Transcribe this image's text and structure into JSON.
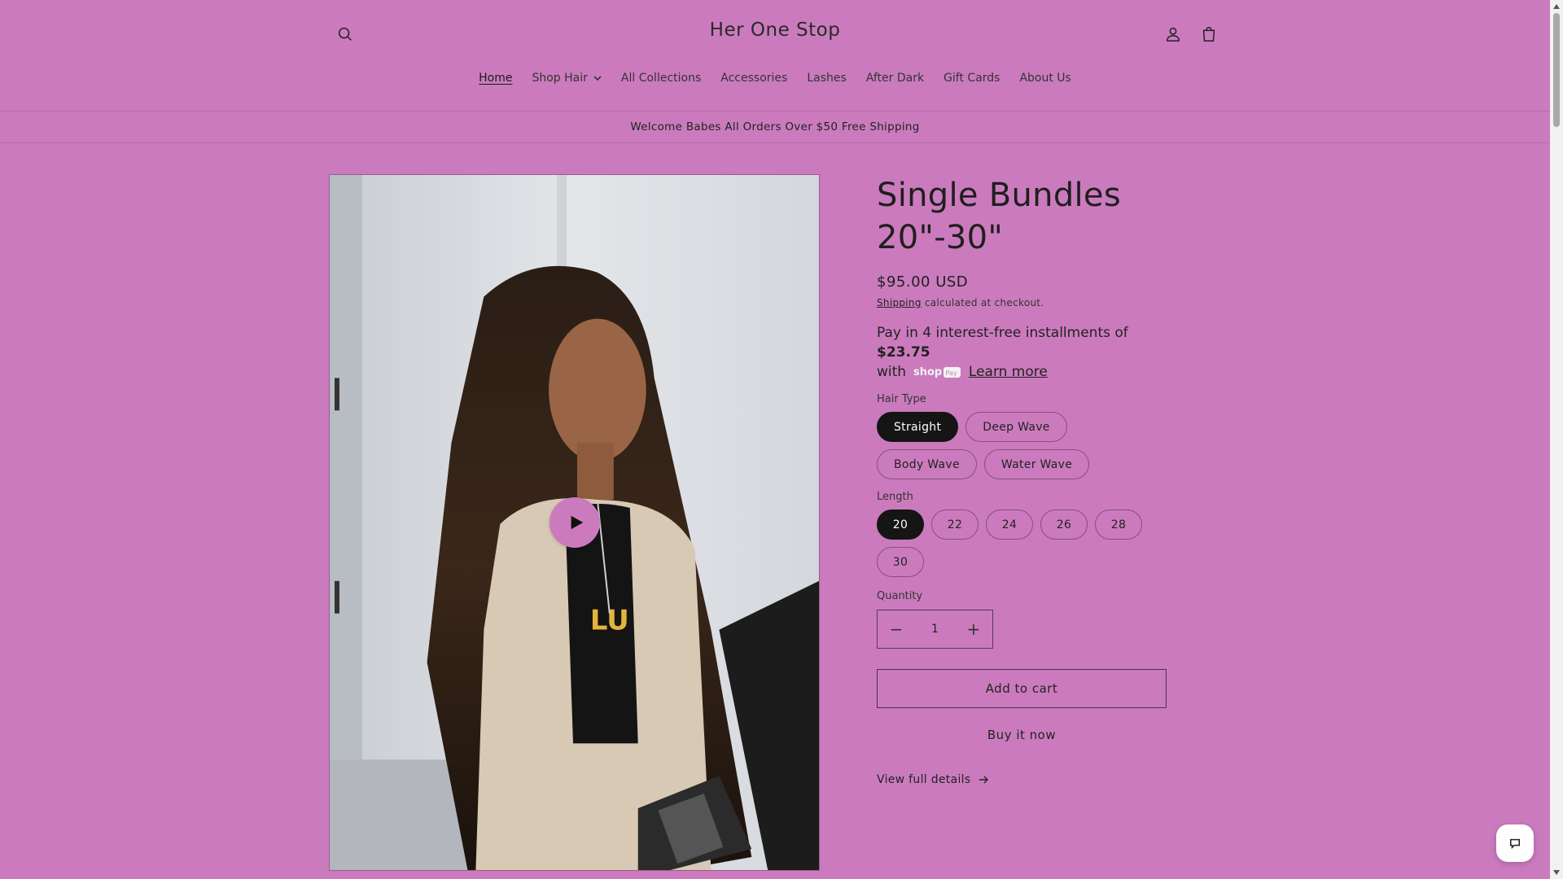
{
  "store": {
    "name": "Her One Stop"
  },
  "nav": [
    {
      "label": "Home",
      "active": true
    },
    {
      "label": "Shop Hair",
      "dropdown": true
    },
    {
      "label": "All Collections"
    },
    {
      "label": "Accessories"
    },
    {
      "label": "Lashes"
    },
    {
      "label": "After Dark"
    },
    {
      "label": "Gift Cards"
    },
    {
      "label": "About Us"
    }
  ],
  "announcement": "Welcome Babes All Orders Over $50 Free Shipping",
  "product": {
    "title": "Single Bundles 20\"-30\"",
    "price": "$95.00 USD",
    "shipping_link": "Shipping",
    "shipping_text": " calculated at checkout.",
    "installments_prefix": "Pay in 4 interest-free installments of ",
    "installments_amount": "$23.75",
    "installments_with": "with",
    "learn_more": "Learn more",
    "hair_type_label": "Hair Type",
    "hair_types": [
      "Straight",
      "Deep Wave",
      "Body Wave",
      "Water Wave"
    ],
    "hair_type_selected": "Straight",
    "length_label": "Length",
    "lengths": [
      "20",
      "22",
      "24",
      "26",
      "28",
      "30"
    ],
    "length_selected": "20",
    "quantity_label": "Quantity",
    "quantity_value": "1",
    "add_to_cart": "Add to cart",
    "buy_now": "Buy it now",
    "view_details": "View full details"
  },
  "colors": {
    "background": "#cb7bbd",
    "selected_pill": "#151515",
    "play_button": "#cb7bbd"
  },
  "icons": {
    "search": "search-icon",
    "account": "account-icon",
    "cart": "cart-icon",
    "play": "play-icon",
    "chat": "chat-icon"
  }
}
